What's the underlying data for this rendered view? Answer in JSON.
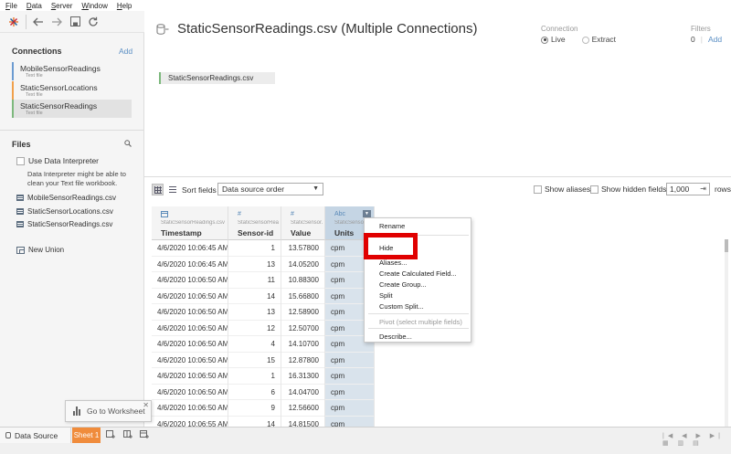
{
  "menubar": [
    "File",
    "Data",
    "Server",
    "Window",
    "Help"
  ],
  "connections": {
    "title": "Connections",
    "add_label": "Add",
    "items": [
      {
        "name": "MobileSensorReadings",
        "sub": "Text file"
      },
      {
        "name": "StaticSensorLocations",
        "sub": "Text file"
      },
      {
        "name": "StaticSensorReadings",
        "sub": "Text file"
      }
    ]
  },
  "files": {
    "title": "Files",
    "interpreter_label": "Use Data Interpreter",
    "interpreter_text": "Data Interpreter might be able to clean your Text file workbook.",
    "items": [
      "MobileSensorReadings.csv",
      "StaticSensorLocations.csv",
      "StaticSensorReadings.csv"
    ],
    "new_union": "New Union"
  },
  "datasource": {
    "title": "StaticSensorReadings.csv (Multiple Connections)",
    "connection_label": "Connection",
    "live": "Live",
    "extract": "Extract",
    "filters_label": "Filters",
    "filters_count": "0",
    "filters_add": "Add",
    "table_pill": "StaticSensorReadings.csv"
  },
  "gridbar": {
    "sort_label": "Sort fields",
    "sort_value": "Data source order",
    "show_aliases": "Show aliases",
    "show_hidden": "Show hidden fields",
    "rows_value": "1,000",
    "rows_label": "rows"
  },
  "columns": [
    {
      "type": "date",
      "source": "StaticSensorReadings.csv",
      "name": "Timestamp"
    },
    {
      "type": "num",
      "source": "StaticSensorRead...",
      "name": "Sensor-id"
    },
    {
      "type": "num",
      "source": "StaticSensor...",
      "name": "Value"
    },
    {
      "type": "str",
      "source": "StaticSensor...",
      "name": "Units"
    }
  ],
  "type_icons": {
    "date": "📅",
    "num": "#",
    "str": "Abc"
  },
  "rows": [
    [
      "4/6/2020 10:06:45 AM",
      "1",
      "13.57800",
      "cpm"
    ],
    [
      "4/6/2020 10:06:45 AM",
      "13",
      "14.05200",
      "cpm"
    ],
    [
      "4/6/2020 10:06:50 AM",
      "11",
      "10.88300",
      "cpm"
    ],
    [
      "4/6/2020 10:06:50 AM",
      "14",
      "15.66800",
      "cpm"
    ],
    [
      "4/6/2020 10:06:50 AM",
      "13",
      "12.58900",
      "cpm"
    ],
    [
      "4/6/2020 10:06:50 AM",
      "12",
      "12.50700",
      "cpm"
    ],
    [
      "4/6/2020 10:06:50 AM",
      "4",
      "14.10700",
      "cpm"
    ],
    [
      "4/6/2020 10:06:50 AM",
      "15",
      "12.87800",
      "cpm"
    ],
    [
      "4/6/2020 10:06:50 AM",
      "1",
      "16.31300",
      "cpm"
    ],
    [
      "4/6/2020 10:06:50 AM",
      "6",
      "14.04700",
      "cpm"
    ],
    [
      "4/6/2020 10:06:50 AM",
      "9",
      "12.56600",
      "cpm"
    ],
    [
      "4/6/2020 10:06:55 AM",
      "14",
      "14.81500",
      "cpm"
    ]
  ],
  "context_menu": {
    "rename": "Rename",
    "hide": "Hide",
    "aliases": "Aliases...",
    "create_calc": "Create Calculated Field...",
    "create_group": "Create Group...",
    "split": "Split",
    "custom_split": "Custom Split...",
    "pivot": "Pivot (select multiple fields)",
    "describe": "Describe..."
  },
  "goto_worksheet": "Go to Worksheet",
  "tabs": {
    "data_source": "Data Source",
    "sheet1": "Sheet 1"
  },
  "colors": {
    "accent_orange": "#f08c3c",
    "highlight_red": "#e00000",
    "link_blue": "#5b8fc4"
  }
}
